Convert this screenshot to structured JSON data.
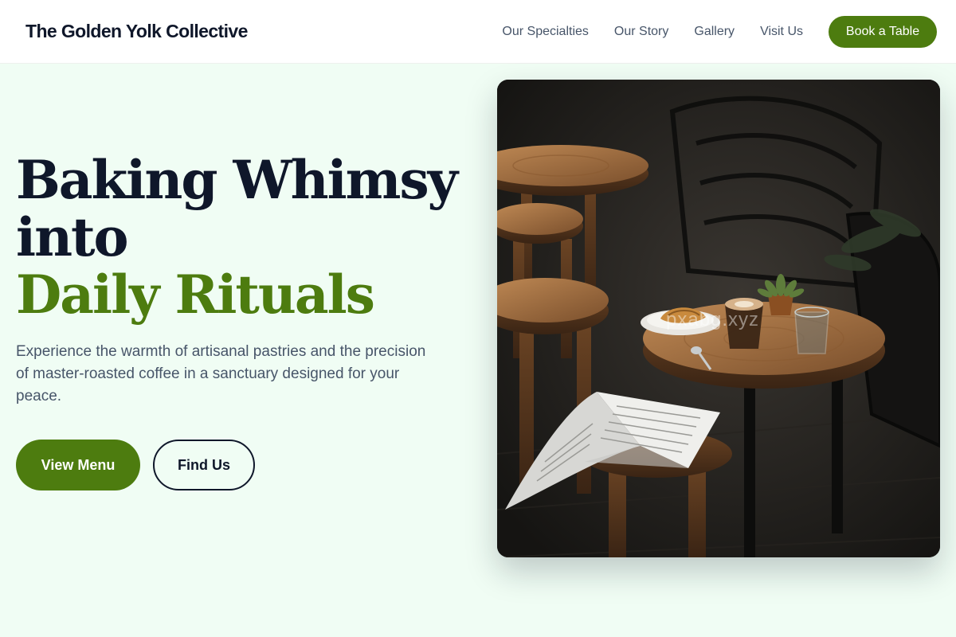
{
  "header": {
    "brand": "The Golden Yolk Collective",
    "nav": [
      "Our Specialties",
      "Our Story",
      "Gallery",
      "Visit Us"
    ],
    "cta": "Book a Table"
  },
  "hero": {
    "headline_line1": "Baking Whimsy into",
    "headline_line2": "Daily Rituals",
    "subtitle": "Experience the warmth of artisanal pastries and the precision of master-roasted coffee in a sanctuary designed for your peace.",
    "primary_cta": "View Menu",
    "secondary_cta": "Find Us",
    "image_watermark": "pxabg.xyz"
  },
  "colors": {
    "brand_green": "#4d7c0f",
    "page_bg": "#f0fdf4",
    "heading": "#0f172a",
    "body_text": "#475569"
  }
}
